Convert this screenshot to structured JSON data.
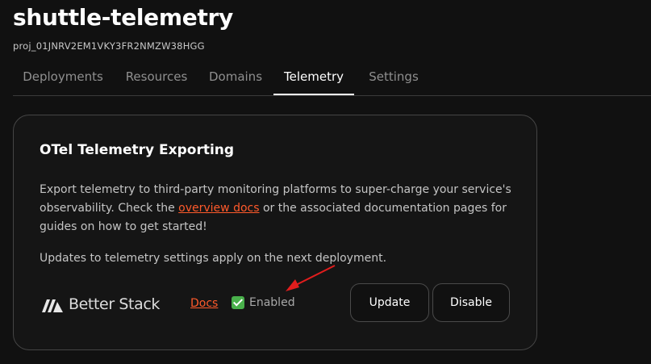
{
  "project": {
    "name": "shuttle-telemetry",
    "id": "proj_01JNRV2EM1VKY3FR2NMZW38HGG"
  },
  "tabs": [
    {
      "label": "Deployments",
      "active": false
    },
    {
      "label": "Resources",
      "active": false
    },
    {
      "label": "Domains",
      "active": false
    },
    {
      "label": "Telemetry",
      "active": true
    },
    {
      "label": "Settings",
      "active": false
    }
  ],
  "card": {
    "title": "OTel Telemetry Exporting",
    "desc_before": "Export telemetry to third-party monitoring platforms to super-charge your service's observability. Check the ",
    "desc_link": "overview docs",
    "desc_after": " or the associated documentation pages for guides on how to get started!",
    "note": "Updates to telemetry settings apply on the next deployment."
  },
  "provider": {
    "name": "Better Stack",
    "docs_label": "Docs",
    "status_label": "Enabled",
    "status_icon": "check-mark-icon",
    "update_label": "Update",
    "disable_label": "Disable"
  },
  "colors": {
    "background": "#111111",
    "accent_link": "#ff5a2b",
    "annotation_arrow": "#e11d1d",
    "status_check": "#49b04b"
  }
}
